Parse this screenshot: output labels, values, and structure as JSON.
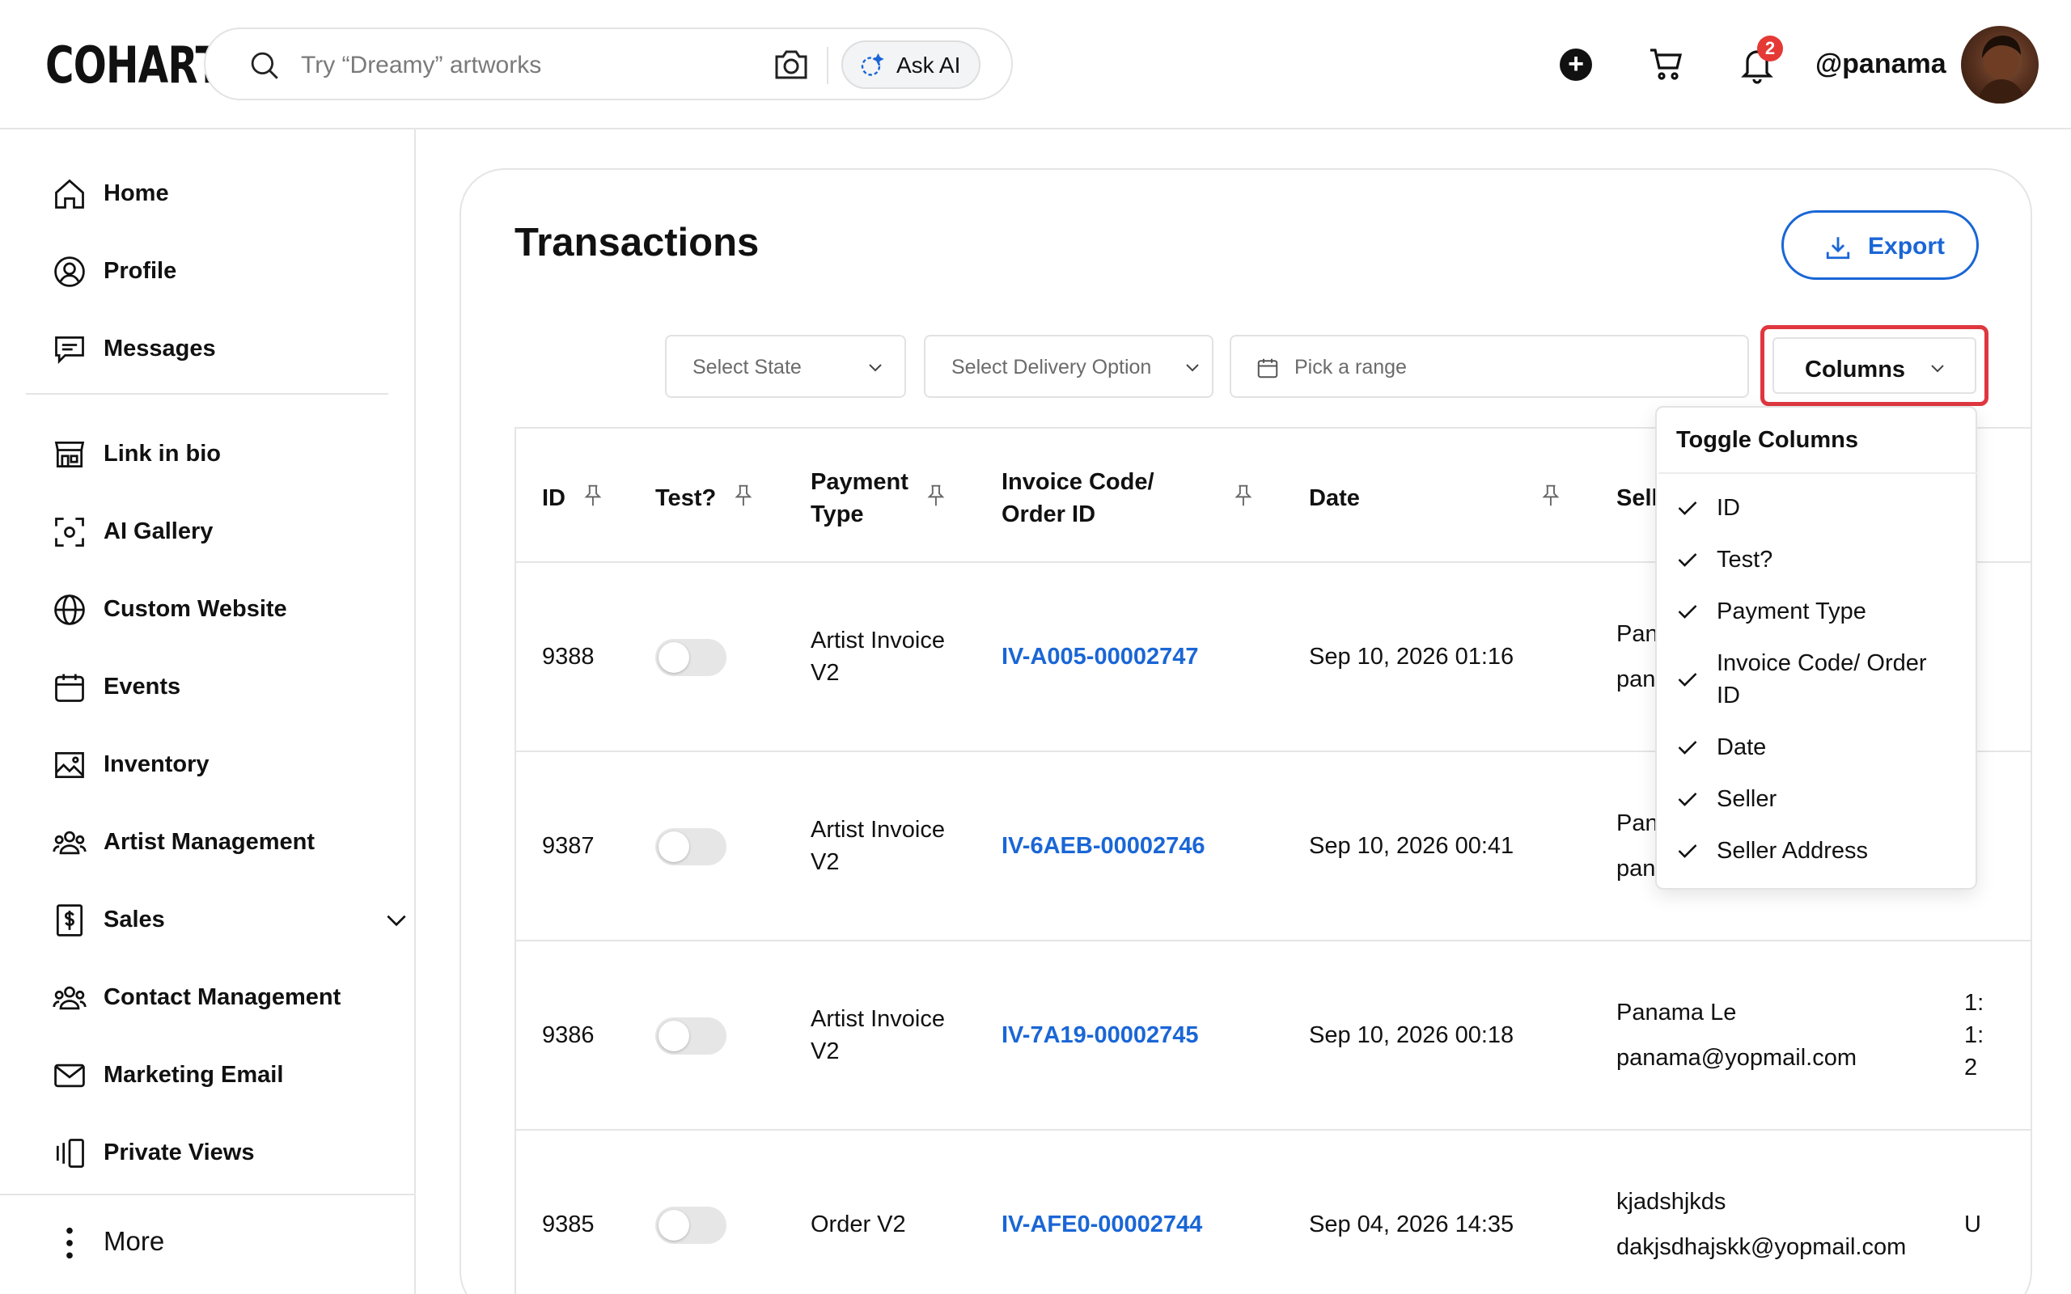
{
  "header": {
    "logo": "COHART",
    "search_placeholder": "Try “Dreamy” artworks",
    "ask_ai_label": "Ask AI",
    "notification_count": "2",
    "username": "@panama"
  },
  "sidebar": {
    "items": [
      {
        "label": "Home",
        "icon": "home-icon"
      },
      {
        "label": "Profile",
        "icon": "user-circle-icon"
      },
      {
        "label": "Messages",
        "icon": "message-icon"
      },
      {
        "label": "Link in bio",
        "icon": "storefront-icon"
      },
      {
        "label": "AI Gallery",
        "icon": "scan-face-icon"
      },
      {
        "label": "Custom Website",
        "icon": "globe-icon"
      },
      {
        "label": "Events",
        "icon": "calendar-icon"
      },
      {
        "label": "Inventory",
        "icon": "image-icon"
      },
      {
        "label": "Artist Management",
        "icon": "users-icon"
      },
      {
        "label": "Sales",
        "icon": "dollar-doc-icon"
      },
      {
        "label": "Contact Management",
        "icon": "users-icon"
      },
      {
        "label": "Marketing Email",
        "icon": "mail-icon"
      },
      {
        "label": "Private Views",
        "icon": "views-icon"
      }
    ],
    "more_label": "More"
  },
  "main": {
    "title": "Transactions",
    "export_label": "Export",
    "filters": {
      "state_placeholder": "Select State",
      "delivery_placeholder": "Select Delivery Option",
      "range_placeholder": "Pick a range",
      "columns_label": "Columns"
    },
    "table": {
      "headers": {
        "id": "ID",
        "test": "Test?",
        "payment_type_1": "Payment",
        "payment_type_2": "Type",
        "invoice_1": "Invoice Code/",
        "invoice_2": "Order ID",
        "date": "Date",
        "seller": "Sell"
      },
      "rows": [
        {
          "id": "9388",
          "payment_1": "Artist Invoice",
          "payment_2": "V2",
          "invoice": "IV-A005-00002747",
          "date": "Sep 10, 2026 01:16",
          "seller_name": "Pan",
          "seller_email": "pan",
          "address": ""
        },
        {
          "id": "9387",
          "payment_1": "Artist Invoice",
          "payment_2": "V2",
          "invoice": "IV-6AEB-00002746",
          "date": "Sep 10, 2026 00:41",
          "seller_name": "Pan",
          "seller_email": "pan",
          "address": ""
        },
        {
          "id": "9386",
          "payment_1": "Artist Invoice",
          "payment_2": "V2",
          "invoice": "IV-7A19-00002745",
          "date": "Sep 10, 2026 00:18",
          "seller_name": "Panama Le",
          "seller_email": "panama@yopmail.com",
          "address_1": "1:",
          "address_2": "1:",
          "address_3": "2"
        },
        {
          "id": "9385",
          "payment_1": "Order V2",
          "payment_2": "",
          "invoice": "IV-AFE0-00002744",
          "date": "Sep 04, 2026 14:35",
          "seller_name": "kjadshjkds",
          "seller_email": "dakjsdhajskk@yopmail.com",
          "address_1": "U"
        }
      ]
    }
  },
  "toggle_columns": {
    "title": "Toggle Columns",
    "items": [
      "ID",
      "Test?",
      "Payment Type",
      "Invoice Code/ Order",
      "ID",
      "Date",
      "Seller",
      "Seller Address"
    ]
  },
  "colors": {
    "accent": "#1a66d6",
    "highlight": "#e0373f",
    "badge": "#e53935"
  }
}
